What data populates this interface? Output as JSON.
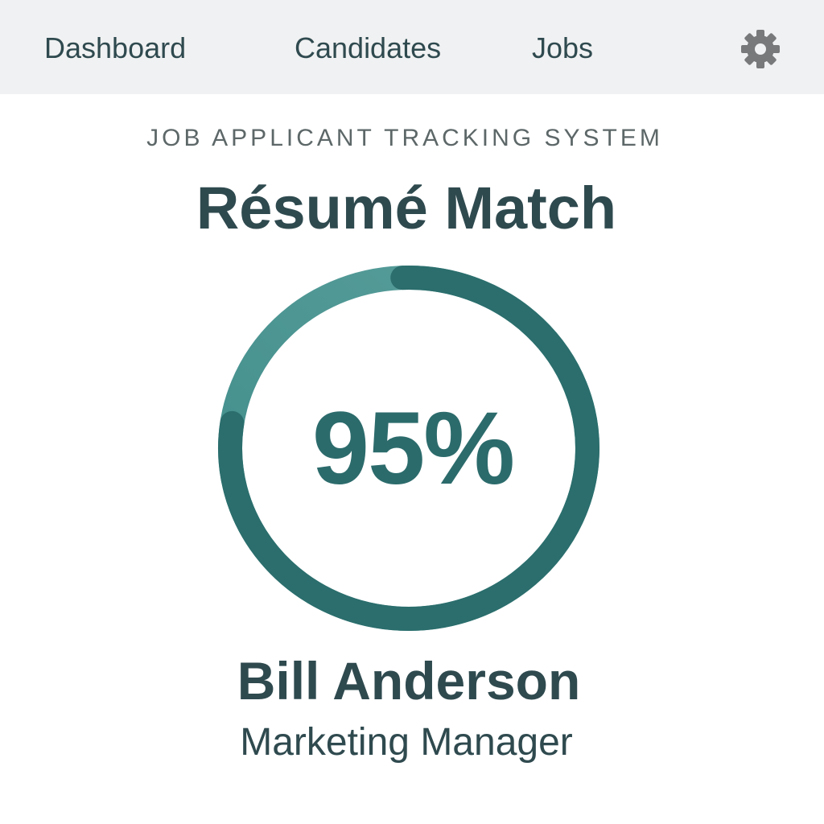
{
  "nav": {
    "items": [
      {
        "label": "Dashboard"
      },
      {
        "label": "Candidates"
      },
      {
        "label": "Jobs"
      }
    ],
    "settings_icon": "gear-icon"
  },
  "header": {
    "subtitle": "JOB APPLICANT TRACKING SYSTEM",
    "title": "Résumé Match"
  },
  "match": {
    "value_text": "95%",
    "fraction": 0.95
  },
  "candidate": {
    "name": "Bill Anderson",
    "role": "Marketing Manager"
  },
  "colors": {
    "nav_background": "#f0f1f2",
    "text_dark": "#2f4a4f",
    "accent_dark": "#2b6e6d",
    "accent_light": "#4f9a98"
  }
}
